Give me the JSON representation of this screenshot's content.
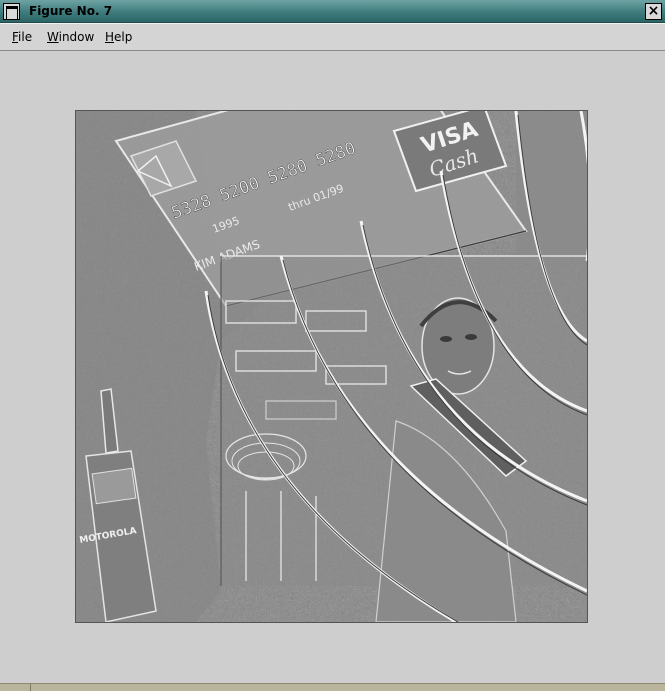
{
  "window": {
    "title": "Figure No. 7"
  },
  "menu": {
    "file": {
      "prefix": "",
      "mnemonic": "F",
      "rest": "ile"
    },
    "window": {
      "prefix": "",
      "mnemonic": "W",
      "rest": "indow"
    },
    "help": {
      "prefix": "",
      "mnemonic": "H",
      "rest": "elp"
    }
  },
  "figure": {
    "card_number": "5328 5200 5280 5280",
    "card_brand_line1": "VISA",
    "card_brand_line2": "Cash",
    "card_year": "1995",
    "card_valid": "thru 01/99",
    "card_holder": "KIM ADAMS",
    "phone_brand": "MOTOROLA",
    "colors": {
      "background": "#8c8c8c",
      "light": "#e6e6e6",
      "dark": "#4a4a4a"
    }
  },
  "icons": {
    "window_menu": "window-menu-icon",
    "close": "close-icon"
  }
}
